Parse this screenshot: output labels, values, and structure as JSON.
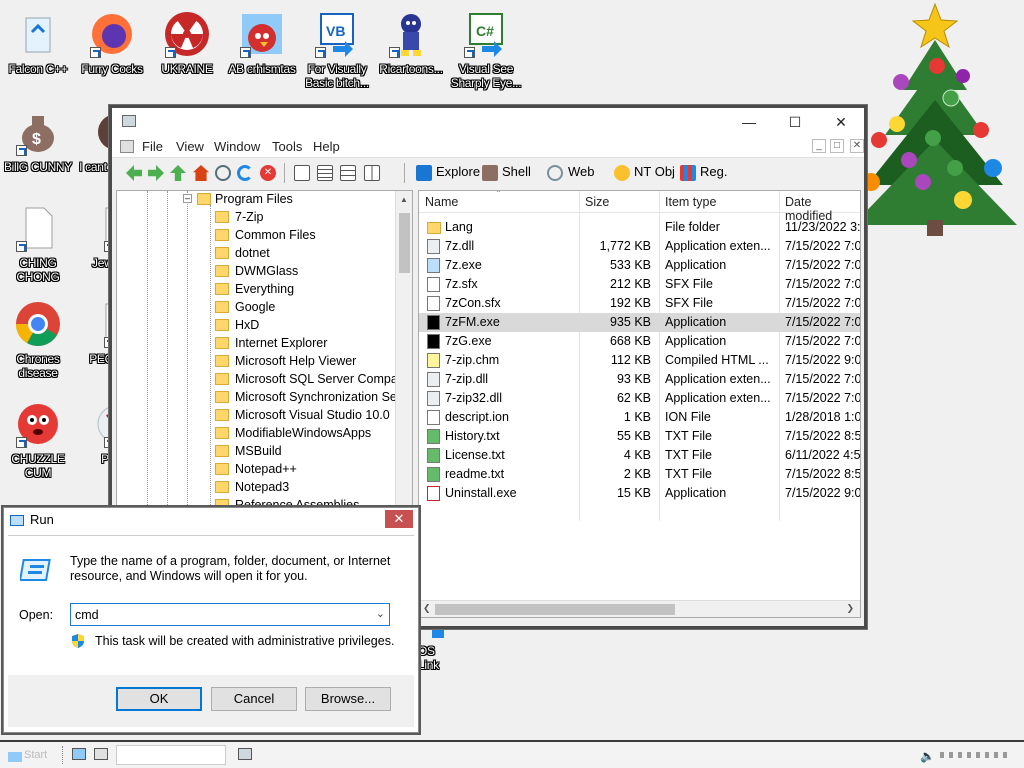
{
  "desktop": {
    "icons": [
      {
        "label": "Falcon C++"
      },
      {
        "label": "Furry Cocks"
      },
      {
        "label": "UKRAINE"
      },
      {
        "label": "AB crhismtas"
      },
      {
        "label": "For Visually Basic bitch..."
      },
      {
        "label": "Ricartoons..."
      },
      {
        "label": "Visual See Sharply Eye..."
      },
      {
        "label": "BillG CUNNY"
      },
      {
        "label": "I cant how F"
      },
      {
        "label": "CHING CHONG"
      },
      {
        "label": "Jews Pale"
      },
      {
        "label": "Chrones disease"
      },
      {
        "label": "PEG LMFA"
      },
      {
        "label": "CHUZZLE CUM"
      },
      {
        "label": "PEG L"
      },
      {
        "label": "OS Link"
      }
    ]
  },
  "filemanager": {
    "menu": [
      "File",
      "View",
      "Window",
      "Tools",
      "Help"
    ],
    "toolbar_labels": {
      "explore": "Explore",
      "shell": "Shell",
      "web": "Web",
      "ntobj": "NT Obj",
      "reg": "Reg."
    },
    "tree": {
      "root": "Program Files",
      "items": [
        "7-Zip",
        "Common Files",
        "dotnet",
        "DWMGlass",
        "Everything",
        "Google",
        "HxD",
        "Internet Explorer",
        "Microsoft Help Viewer",
        "Microsoft SQL Server Compact",
        "Microsoft Synchronization Serv",
        "Microsoft Visual Studio 10.0",
        "ModifiableWindowsApps",
        "MSBuild",
        "Notepad++",
        "Notepad3",
        "Reference Assemblies"
      ]
    },
    "columns": {
      "name": "Name",
      "size": "Size",
      "type": "Item type",
      "date": "Date modified"
    },
    "files": [
      {
        "name": "Lang",
        "size": "",
        "type": "File folder",
        "date": "11/23/2022 3:1"
      },
      {
        "name": "7z.dll",
        "size": "1,772 KB",
        "type": "Application exten...",
        "date": "7/15/2022 7:00"
      },
      {
        "name": "7z.exe",
        "size": "533 KB",
        "type": "Application",
        "date": "7/15/2022 7:00"
      },
      {
        "name": "7z.sfx",
        "size": "212 KB",
        "type": "SFX File",
        "date": "7/15/2022 7:00"
      },
      {
        "name": "7zCon.sfx",
        "size": "192 KB",
        "type": "SFX File",
        "date": "7/15/2022 7:00"
      },
      {
        "name": "7zFM.exe",
        "size": "935 KB",
        "type": "Application",
        "date": "7/15/2022 7:00"
      },
      {
        "name": "7zG.exe",
        "size": "668 KB",
        "type": "Application",
        "date": "7/15/2022 7:00"
      },
      {
        "name": "7-zip.chm",
        "size": "112 KB",
        "type": "Compiled HTML ...",
        "date": "7/15/2022 9:00"
      },
      {
        "name": "7-zip.dll",
        "size": "93 KB",
        "type": "Application exten...",
        "date": "7/15/2022 7:00"
      },
      {
        "name": "7-zip32.dll",
        "size": "62 KB",
        "type": "Application exten...",
        "date": "7/15/2022 7:00"
      },
      {
        "name": "descript.ion",
        "size": "1 KB",
        "type": "ION File",
        "date": "1/28/2018 1:00"
      },
      {
        "name": "History.txt",
        "size": "55 KB",
        "type": "TXT File",
        "date": "7/15/2022 8:59"
      },
      {
        "name": "License.txt",
        "size": "4 KB",
        "type": "TXT File",
        "date": "6/11/2022 4:57"
      },
      {
        "name": "readme.txt",
        "size": "2 KB",
        "type": "TXT File",
        "date": "7/15/2022 8:59"
      },
      {
        "name": "Uninstall.exe",
        "size": "15 KB",
        "type": "Application",
        "date": "7/15/2022 9:00"
      }
    ],
    "selected_file": "7zFM.exe"
  },
  "run": {
    "title": "Run",
    "description": "Type the name of a program, folder, document, or Internet resource, and Windows will open it for you.",
    "open_label": "Open:",
    "value": "cmd",
    "admin_note": "This task will be created with administrative privileges.",
    "ok": "OK",
    "cancel": "Cancel",
    "browse": "Browse..."
  },
  "taskbar": {
    "start": "Start"
  }
}
